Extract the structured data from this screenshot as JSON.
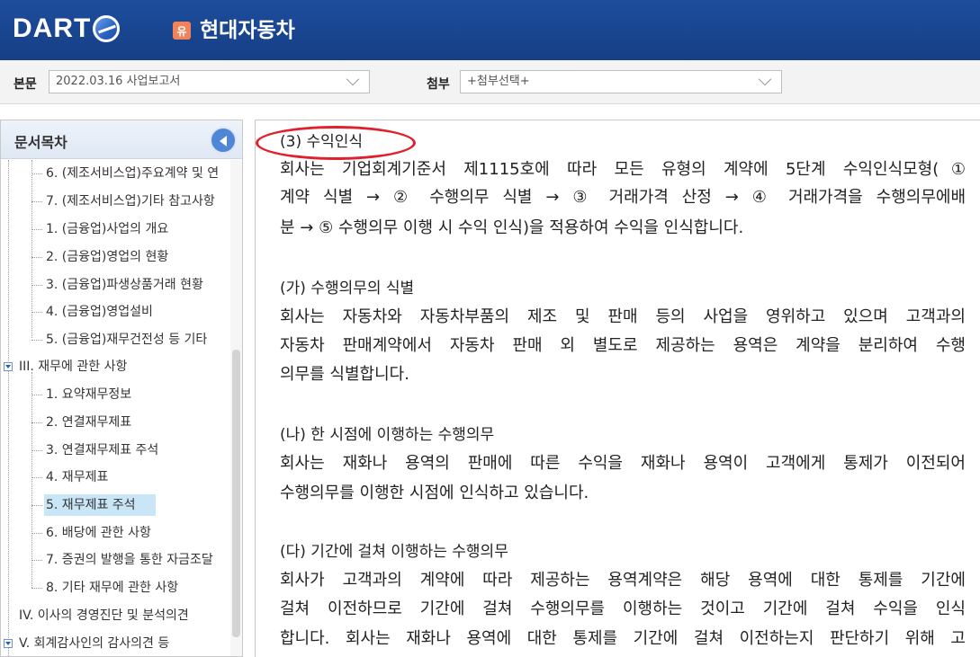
{
  "header": {
    "logo_text": "DART",
    "company_badge": "유",
    "company_name": "현대자동차"
  },
  "selectbar": {
    "body_label": "본문",
    "body_value": "2022.03.16  사업보고서",
    "attach_label": "첨부",
    "attach_value": "+첨부선택+"
  },
  "sidebar": {
    "title": "문서목차",
    "items": [
      {
        "label": "6. (제조서비스업)주요계약 및 연",
        "level": 2
      },
      {
        "label": "7. (제조서비스업)기타 참고사항",
        "level": 2
      },
      {
        "label": "1. (금융업)사업의 개요",
        "level": 2
      },
      {
        "label": "2. (금융업)영업의 현황",
        "level": 2
      },
      {
        "label": "3. (금융업)파생상품거래 현황",
        "level": 2
      },
      {
        "label": "4. (금융업)영업설비",
        "level": 2
      },
      {
        "label": "5. (금융업)재무건전성 등 기타",
        "level": 2
      },
      {
        "label": "III. 재무에 관한 사항",
        "level": 1
      },
      {
        "label": "1. 요약재무정보",
        "level": 2
      },
      {
        "label": "2. 연결재무제표",
        "level": 2
      },
      {
        "label": "3. 연결재무제표 주석",
        "level": 2
      },
      {
        "label": "4. 재무제표",
        "level": 2
      },
      {
        "label": "5. 재무제표 주석",
        "level": 2,
        "selected": true
      },
      {
        "label": "6. 배당에 관한 사항",
        "level": 2
      },
      {
        "label": "7. 증권의 발행을 통한 자금조달",
        "level": 2
      },
      {
        "label": "8. 기타 재무에 관한 사항",
        "level": 2
      },
      {
        "label": "IV. 이사의 경영진단 및 분석의견",
        "level": 1
      },
      {
        "label": "V. 회계감사인의 감사의견 등",
        "level": 1
      }
    ]
  },
  "content": {
    "lines": [
      "(3) 수익인식",
      "회사는 기업회계기준서 제1115호에 따라 모든 유형의 계약에 5단계 수익인식모형(①",
      "계약 식별 → ② 수행의무 식별 → ③ 거래가격 산정 → ④ 거래가격을 수행의무에배",
      "분 → ⑤ 수행의무 이행 시 수익 인식)을 적용하여 수익을 인식합니다.",
      "(가) 수행의무의 식별",
      "회사는 자동차와 자동차부품의 제조 및 판매 등의 사업을 영위하고 있으며 고객과의",
      "자동차 판매계약에서 자동차 판매 외 별도로 제공하는 용역은 계약을 분리하여 수행",
      "의무를 식별합니다.",
      "(나) 한 시점에 이행하는 수행의무",
      "회사는 재화나 용역의 판매에 따른 수익을 재화나 용역이 고객에게 통제가 이전되어",
      "수행의무를 이행한 시점에 인식하고 있습니다.",
      "(다) 기간에 걸쳐 이행하는 수행의무",
      "회사가 고객과의 계약에 따라 제공하는 용역계약은 해당 용역에 대한 통제를 기간에",
      "걸쳐 이전하므로 기간에 걸쳐 수행의무를 이행하는 것이고 기간에 걸쳐 수익을 인식",
      "합니다. 회사는 재화나 용역에 대한 통제를 기간에 걸쳐 이전하는지 판단하기 위해 고"
    ]
  }
}
